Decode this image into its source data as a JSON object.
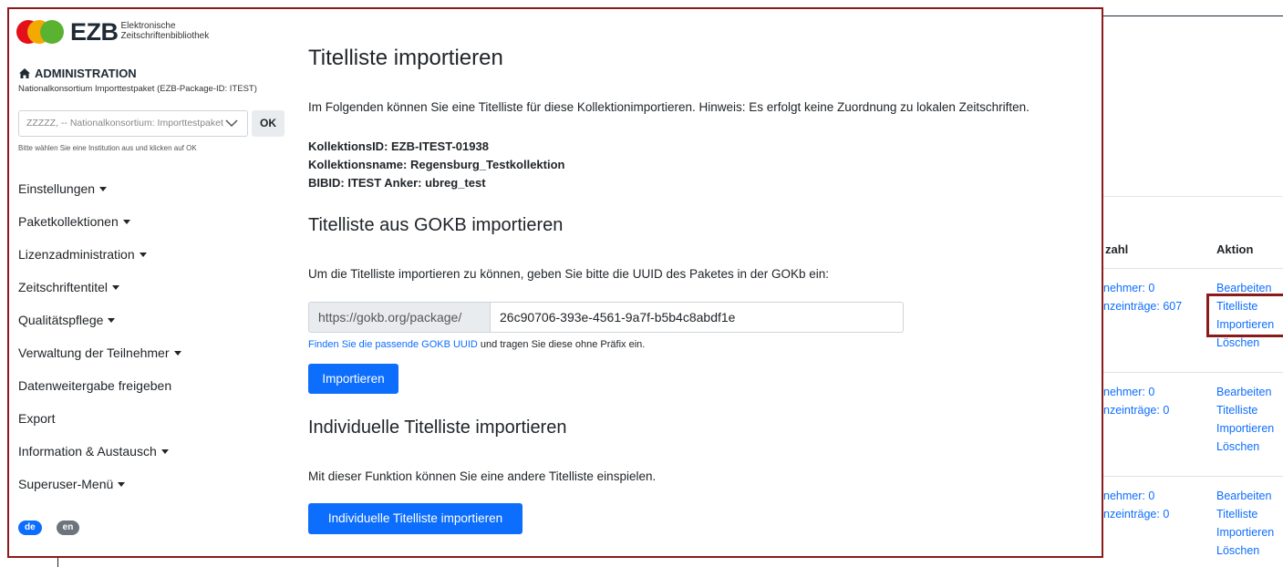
{
  "background": {
    "header_zahl": "zahl",
    "header_aktion": "Aktion",
    "rows": [
      {
        "teilnehmer": "nehmer: 0",
        "eintraege": "nzeinträge: 607",
        "actions": [
          "Bearbeiten",
          "Titelliste",
          "Importieren",
          "Löschen"
        ]
      },
      {
        "teilnehmer": "nehmer: 0",
        "eintraege": "nzeinträge: 0",
        "actions": [
          "Bearbeiten",
          "Titelliste",
          "Importieren",
          "Löschen"
        ]
      },
      {
        "teilnehmer": "nehmer: 0",
        "eintraege": "nzeinträge: 0",
        "actions": [
          "Bearbeiten",
          "Titelliste",
          "Importieren",
          "Löschen"
        ]
      }
    ]
  },
  "sidebar": {
    "logo": {
      "text": "EZB",
      "sub_line1": "Elektronische",
      "sub_line2": "Zeitschriftenbibliothek"
    },
    "admin_title": "ADMINISTRATION",
    "admin_subtitle": "Nationalkonsortium Importtestpaket (EZB-Package-ID: ITEST)",
    "institution_select": "ZZZZZ, -- Nationalkonsortium: Importtestpaket",
    "ok_label": "OK",
    "institution_hint": "Bitte wählen Sie eine Institution aus und klicken auf OK",
    "nav": [
      {
        "label": "Einstellungen",
        "dropdown": true
      },
      {
        "label": "Paketkollektionen",
        "dropdown": true
      },
      {
        "label": "Lizenzadministration",
        "dropdown": true
      },
      {
        "label": "Zeitschriftentitel",
        "dropdown": true
      },
      {
        "label": "Qualitätspflege",
        "dropdown": true
      },
      {
        "label": "Verwaltung der Teilnehmer",
        "dropdown": true
      },
      {
        "label": "Datenweitergabe freigeben",
        "dropdown": false
      },
      {
        "label": "Export",
        "dropdown": false
      },
      {
        "label": "Information & Austausch",
        "dropdown": true
      },
      {
        "label": "Superuser-Menü",
        "dropdown": true
      }
    ],
    "languages": [
      "de",
      "en"
    ]
  },
  "main": {
    "title": "Titelliste importieren",
    "intro": "Im Folgenden können Sie eine Titelliste für diese Kollektionimportieren. Hinweis: Es erfolgt keine Zuordnung zu lokalen Zeitschriften.",
    "kollektions_id": "KollektionsID: EZB-ITEST-01938",
    "kollektionsname": "Kollektionsname: Regensburg_Testkollektion",
    "bibid": "BIBID: ITEST Anker: ubreg_test",
    "gokb_heading": "Titelliste aus GOKB importieren",
    "gokb_description": "Um die Titelliste importieren zu können, geben Sie bitte die UUID des Paketes in der GOKb ein:",
    "gokb_prefix": "https://gokb.org/package/",
    "gokb_uuid": "26c90706-393e-4561-9a7f-b5b4c8abdf1e",
    "gokb_hint_link": "Finden Sie die passende GOKB UUID",
    "gokb_hint_text": " und tragen Sie diese ohne Präfix ein.",
    "import_button": "Importieren",
    "individual_heading": "Individuelle Titelliste importieren",
    "individual_description": "Mit dieser Funktion können Sie eine andere Titelliste einspielen.",
    "individual_button": "Individuelle Titelliste importieren"
  },
  "colors": {
    "primary": "#0d6efd",
    "highlight_border": "#8b1a1a",
    "logo_red": "#e3101b",
    "logo_orange": "#f5a800",
    "logo_green": "#59b331"
  }
}
